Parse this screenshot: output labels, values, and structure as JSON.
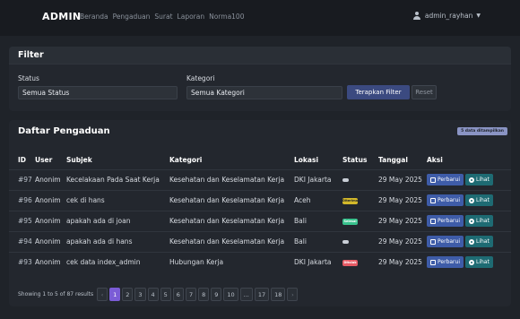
{
  "navbar": {
    "brand": "ADMIN",
    "links": [
      "Beranda",
      "Pengaduan",
      "Surat",
      "Laporan",
      "Norma100"
    ],
    "user": "admin_rayhan"
  },
  "filter": {
    "title": "Filter",
    "status_label": "Status",
    "status_value": "Semua Status",
    "kategori_label": "Kategori",
    "kategori_value": "Semua Kategori",
    "apply_label": "Terapkan Filter",
    "reset_label": "Reset"
  },
  "list": {
    "title": "Daftar Pengaduan",
    "count_badge": "5 data ditampilkan",
    "columns": [
      "ID",
      "User",
      "Subjek",
      "Kategori",
      "Lokasi",
      "Status",
      "Tanggal",
      "Aksi"
    ],
    "rows": [
      {
        "id": "#97",
        "user": "Anonim",
        "subjek": "Kecelakaan Pada Saat Kerja",
        "kategori": "Kesehatan dan Keselamatan Kerja",
        "lokasi": "DKI Jakarta",
        "status": "",
        "status_color": "gray",
        "tanggal": "29 May 2025"
      },
      {
        "id": "#96",
        "user": "Anonim",
        "subjek": "cek di hans",
        "kategori": "Kesehatan dan Keselamatan Kerja",
        "lokasi": "Aceh",
        "status": "Diterima",
        "status_color": "yellow",
        "tanggal": "29 May 2025"
      },
      {
        "id": "#95",
        "user": "Anonim",
        "subjek": "apakah ada di joan",
        "kategori": "Kesehatan dan Keselamatan Kerja",
        "lokasi": "Bali",
        "status": "Selesai",
        "status_color": "green",
        "tanggal": "29 May 2025"
      },
      {
        "id": "#94",
        "user": "Anonim",
        "subjek": "apakah ada di hans",
        "kategori": "Kesehatan dan Keselamatan Kerja",
        "lokasi": "Bali",
        "status": "",
        "status_color": "gray",
        "tanggal": "29 May 2025"
      },
      {
        "id": "#93",
        "user": "Anonim",
        "subjek": "cek data index_admin",
        "kategori": "Hubungan Kerja",
        "lokasi": "DKI Jakarta",
        "status": "Ditolak",
        "status_color": "red",
        "tanggal": "29 May 2025"
      }
    ],
    "action_edit": "Perbarui",
    "action_view": "Lihat"
  },
  "pagination": {
    "info": "Showing 1 to 5 of 87 results",
    "prev": "‹",
    "pages": [
      "1",
      "2",
      "3",
      "4",
      "5",
      "6",
      "7",
      "8",
      "9",
      "10",
      "...",
      "17",
      "18"
    ],
    "current": "1",
    "next": "›"
  },
  "colors": {
    "accent": "#7b5cd6",
    "apply_button": "#3b4a80",
    "edit_button": "#3e5ca8",
    "view_button": "#1e6b73"
  }
}
